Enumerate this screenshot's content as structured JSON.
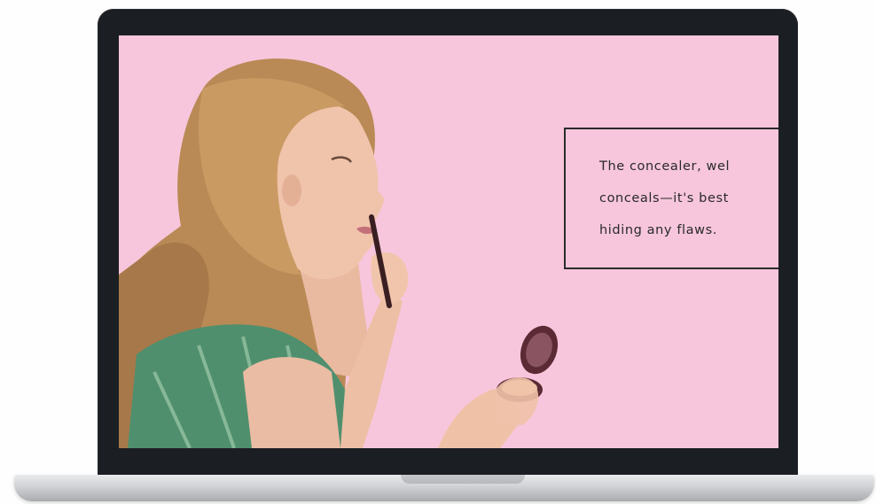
{
  "caption": {
    "line1": "The concealer, wel",
    "line2": "conceals—it's best",
    "line3": "hiding any flaws."
  },
  "colors": {
    "screen_background": "#f7c6dc",
    "bezel": "#1b1e23",
    "caption_border": "#2b2b2b"
  },
  "icons": {
    "device": "laptop-icon"
  }
}
